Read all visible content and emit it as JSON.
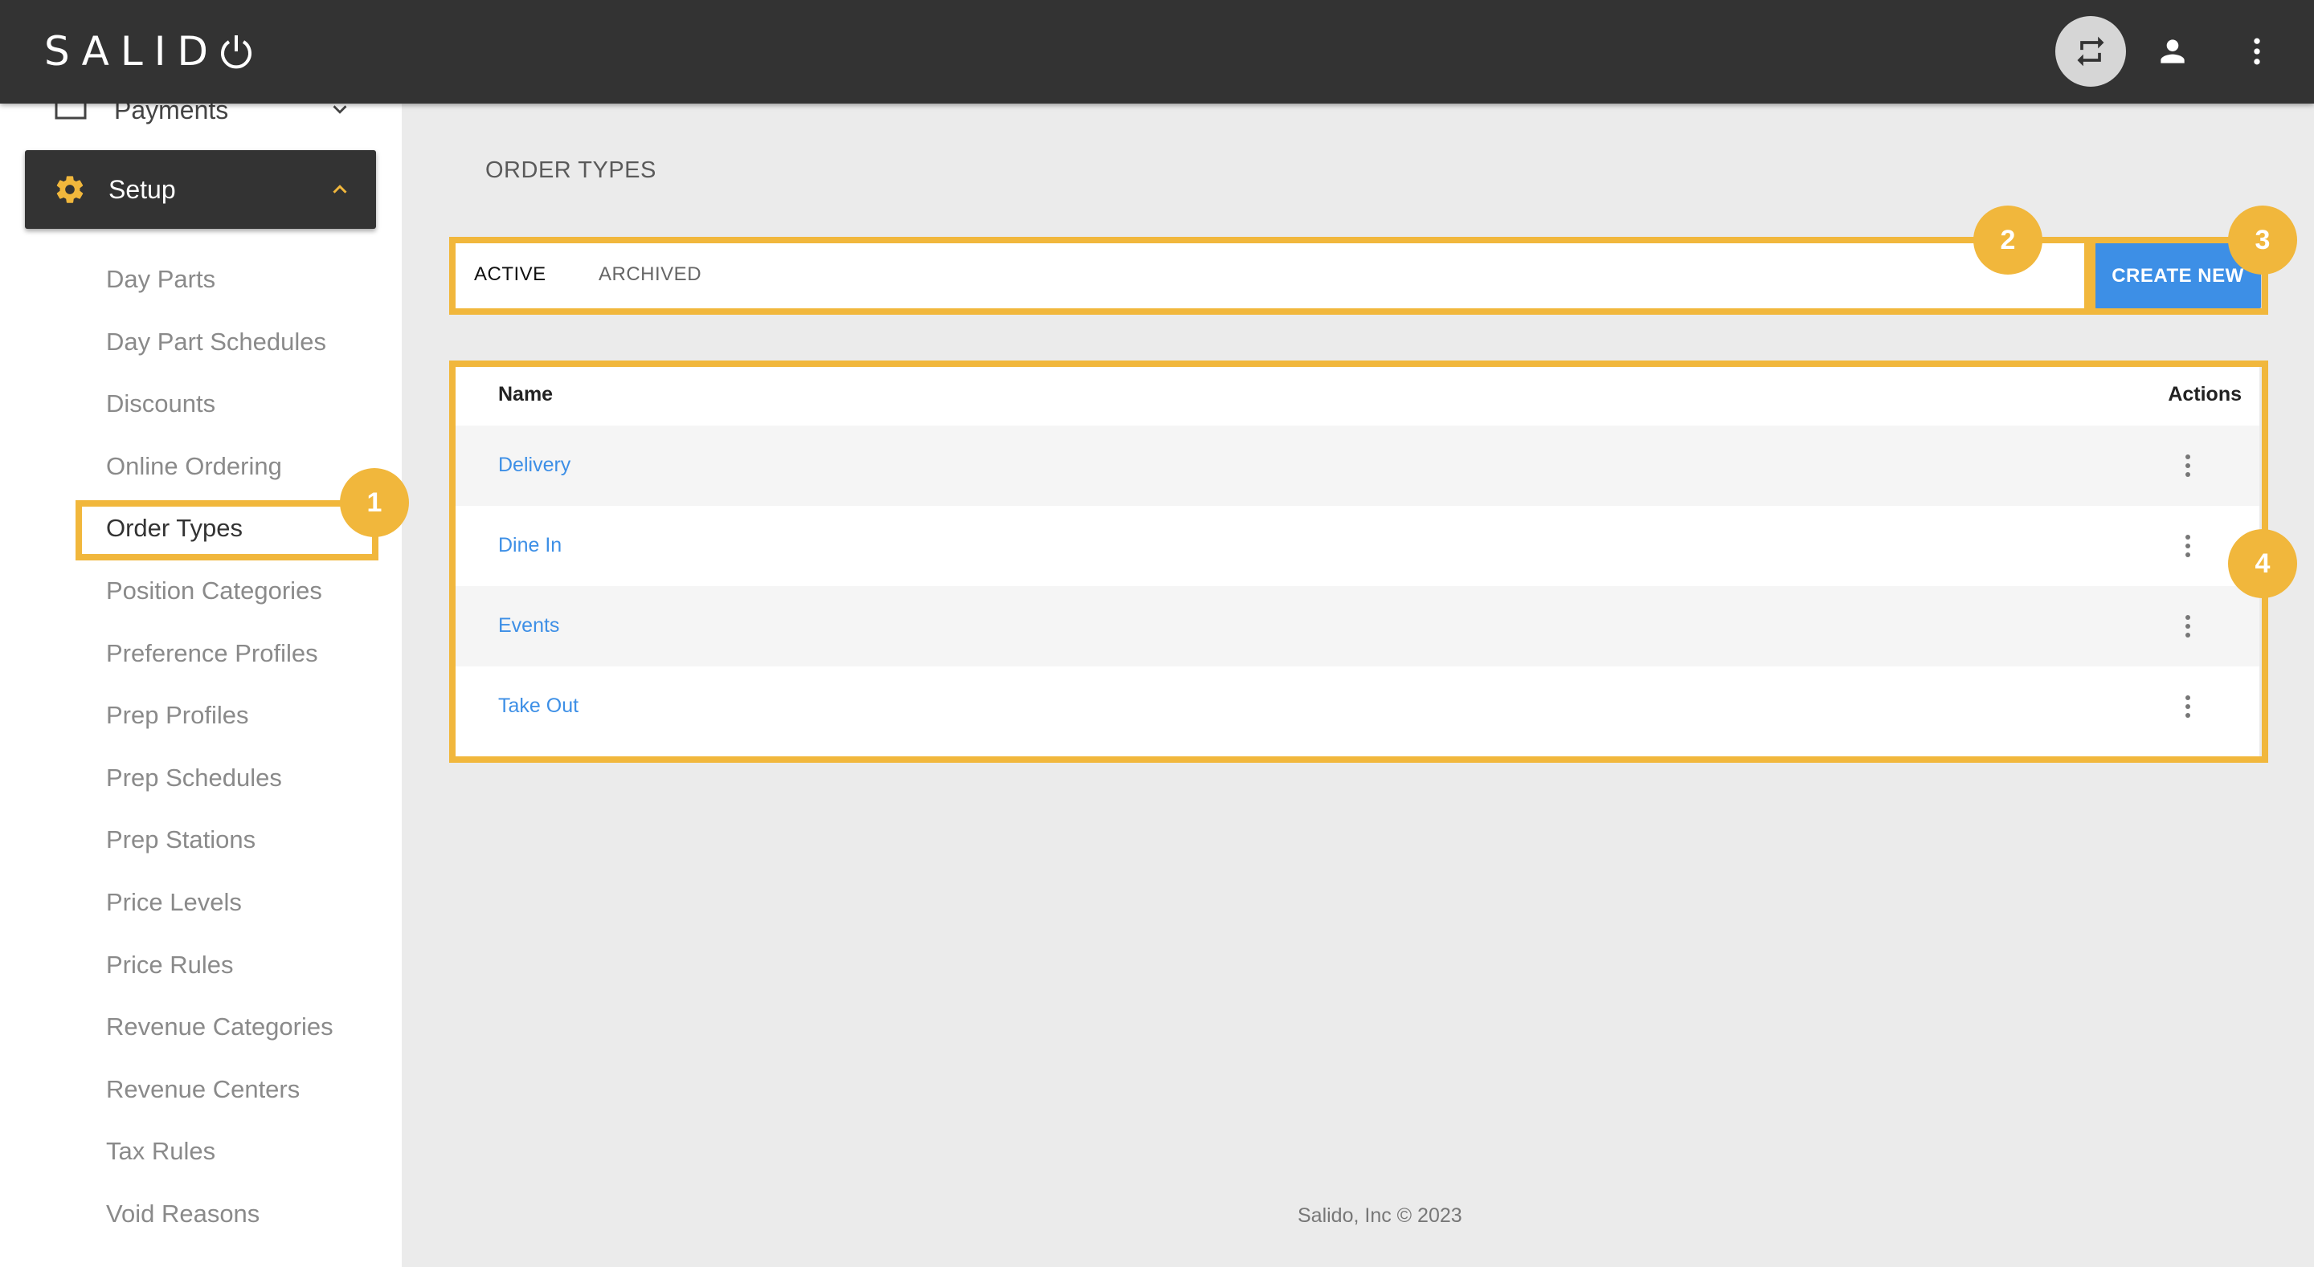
{
  "app": {
    "logo_text": "SALIDO",
    "topbar_icons": [
      "switch-location-icon",
      "user-icon",
      "more-vert-icon"
    ]
  },
  "sidebar": {
    "payments_label": "Payments",
    "setup_label": "Setup",
    "items": [
      {
        "label": "Day Parts"
      },
      {
        "label": "Day Part Schedules"
      },
      {
        "label": "Discounts"
      },
      {
        "label": "Online Ordering"
      },
      {
        "label": "Order Types",
        "active": true
      },
      {
        "label": "Position Categories"
      },
      {
        "label": "Preference Profiles"
      },
      {
        "label": "Prep Profiles"
      },
      {
        "label": "Prep Schedules"
      },
      {
        "label": "Prep Stations"
      },
      {
        "label": "Price Levels"
      },
      {
        "label": "Price Rules"
      },
      {
        "label": "Revenue Categories"
      },
      {
        "label": "Revenue Centers"
      },
      {
        "label": "Tax Rules"
      },
      {
        "label": "Void Reasons"
      }
    ]
  },
  "main": {
    "title": "ORDER TYPES",
    "tabs": [
      {
        "label": "ACTIVE",
        "active": true
      },
      {
        "label": "ARCHIVED",
        "active": false
      }
    ],
    "create_button": "CREATE NEW",
    "table": {
      "headers": {
        "name": "Name",
        "actions": "Actions"
      },
      "rows": [
        {
          "name": "Delivery"
        },
        {
          "name": "Dine In"
        },
        {
          "name": "Events"
        },
        {
          "name": "Take Out"
        }
      ]
    }
  },
  "footer": {
    "text": "Salido, Inc © 2023"
  },
  "annotations": {
    "badges": [
      "1",
      "2",
      "3",
      "4"
    ],
    "color": "#f1b73c"
  },
  "colors": {
    "topbar": "#333333",
    "accent_blue": "#3d8fe6",
    "background": "#ebebeb"
  }
}
